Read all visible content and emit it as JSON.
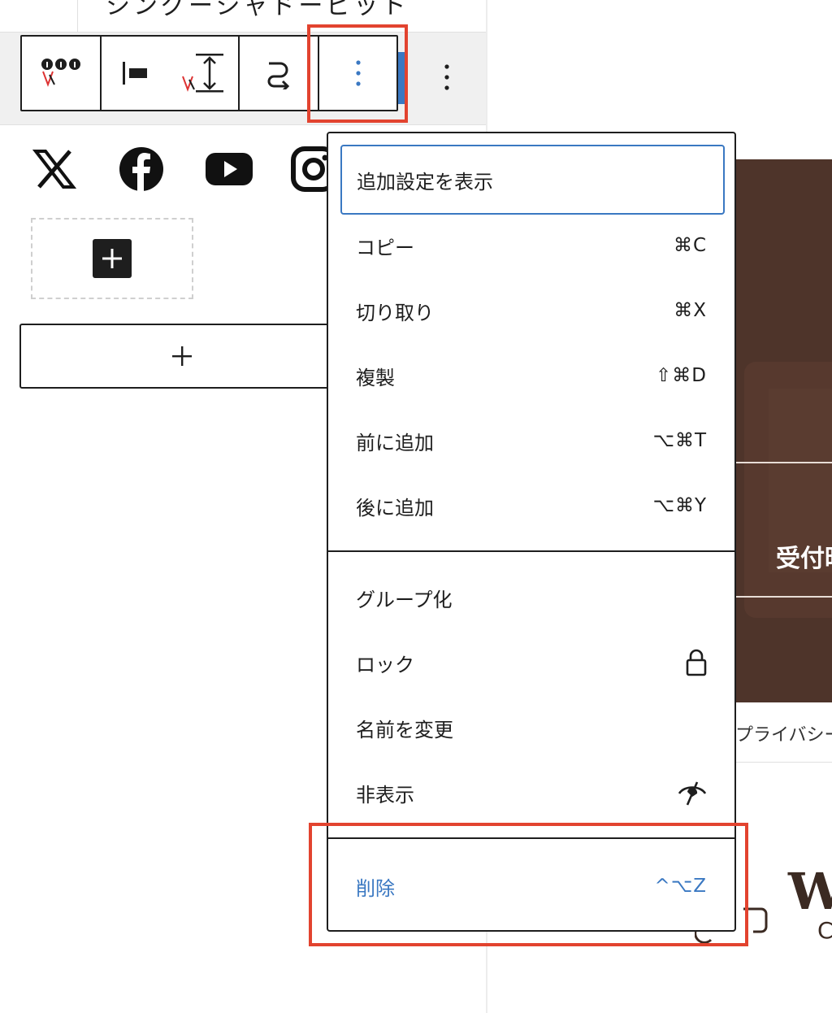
{
  "editor": {
    "partial_title": "シングーシャドービット",
    "button_appender_symbol": "+",
    "brown_text": "受付時",
    "privacy_text": "プライバシーポリシー",
    "logo_letter": "W",
    "logo_sub": "C"
  },
  "toolbar": {
    "buttons": [
      {
        "icon": "block-type-icon"
      },
      {
        "icon": "justify-left-icon"
      },
      {
        "icon": "vertical-spacing-icon"
      },
      {
        "icon": "transform-icon"
      },
      {
        "icon": "more-options-icon"
      }
    ]
  },
  "menu": {
    "show_more_settings": "追加設定を表示",
    "copy": {
      "label": "コピー",
      "shortcut": "⌘C"
    },
    "cut": {
      "label": "切り取り",
      "shortcut": "⌘X"
    },
    "duplicate": {
      "label": "複製",
      "shortcut": "⇧⌘D"
    },
    "insert_before": {
      "label": "前に追加",
      "shortcut": "⌥⌘T"
    },
    "insert_after": {
      "label": "後に追加",
      "shortcut": "⌥⌘Y"
    },
    "group": {
      "label": "グループ化"
    },
    "lock": {
      "label": "ロック",
      "icon": "lock-icon"
    },
    "rename": {
      "label": "名前を変更"
    },
    "hide": {
      "label": "非表示",
      "icon": "eye-hidden-icon"
    },
    "delete": {
      "label": "削除",
      "shortcut": "^⌥Z"
    }
  },
  "colors": {
    "highlight": "#e2432f",
    "accent": "#3a78c2",
    "brown": "#4e342a"
  }
}
